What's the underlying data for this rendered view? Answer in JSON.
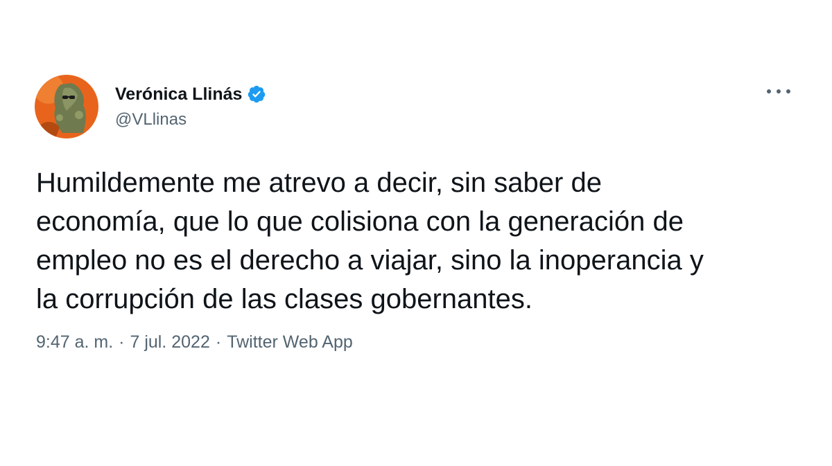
{
  "author": {
    "display_name": "Verónica Llinás",
    "handle": "@VLlinas",
    "verified": true,
    "avatar_icon": "profile-avatar"
  },
  "tweet": {
    "lines": [
      "Humildemente me atrevo a decir, sin saber de",
      "economía, que lo que colisiona con la generación de",
      "empleo no es el derecho a viajar, sino la inoperancia y",
      "la corrupción de las clases gobernantes."
    ]
  },
  "meta": {
    "time": "9:47 a. m.",
    "separator": "·",
    "date": "7 jul. 2022",
    "source": "Twitter Web App"
  },
  "icons": {
    "more": "more-options-icon",
    "verified": "verified-badge-icon"
  },
  "colors": {
    "accent": "#1d9bf0",
    "secondary_text": "#536471",
    "primary_text": "#0f1419",
    "avatar_bg": "#e8641c"
  }
}
